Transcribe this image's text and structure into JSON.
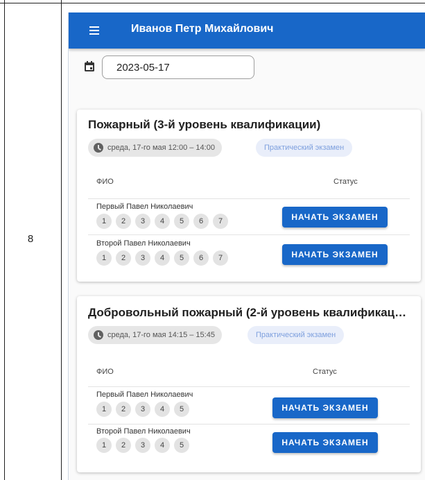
{
  "row_number": "8",
  "app": {
    "title": "Иванов Петр Михайлович",
    "date_value": "2023-05-17"
  },
  "header": {
    "fio": "ФИО",
    "status": "Статус"
  },
  "exams": [
    {
      "title": "Пожарный (3-й уровень квалификации)",
      "time": "среда, 17-го мая 12:00 – 14:00",
      "type": "Практический экзамен",
      "button_label": "НАЧАТЬ ЭКЗАМЕН",
      "students": [
        {
          "name": "Первый Павел Николаевич",
          "steps": [
            "1",
            "2",
            "3",
            "4",
            "5",
            "6",
            "7"
          ]
        },
        {
          "name": "Второй Павел Николаевич",
          "steps": [
            "1",
            "2",
            "3",
            "4",
            "5",
            "6",
            "7"
          ]
        }
      ]
    },
    {
      "title": "Добровольный пожарный (2-й уровень квалификац…",
      "time": "среда, 17-го мая 14:15 – 15:45",
      "type": "Практический экзамен",
      "button_label": "НАЧАТЬ ЭКЗАМЕН",
      "students": [
        {
          "name": "Первый Павел Николаевич",
          "steps": [
            "1",
            "2",
            "3",
            "4",
            "5"
          ]
        },
        {
          "name": "Второй Павел Николаевич",
          "steps": [
            "1",
            "2",
            "3",
            "4",
            "5"
          ]
        }
      ]
    }
  ],
  "icons": {
    "menu": "menu-icon",
    "calendar": "calendar-icon",
    "clock": "clock-icon"
  },
  "colors": {
    "primary": "#1867c8",
    "chip_type_text": "#7ea0de"
  }
}
